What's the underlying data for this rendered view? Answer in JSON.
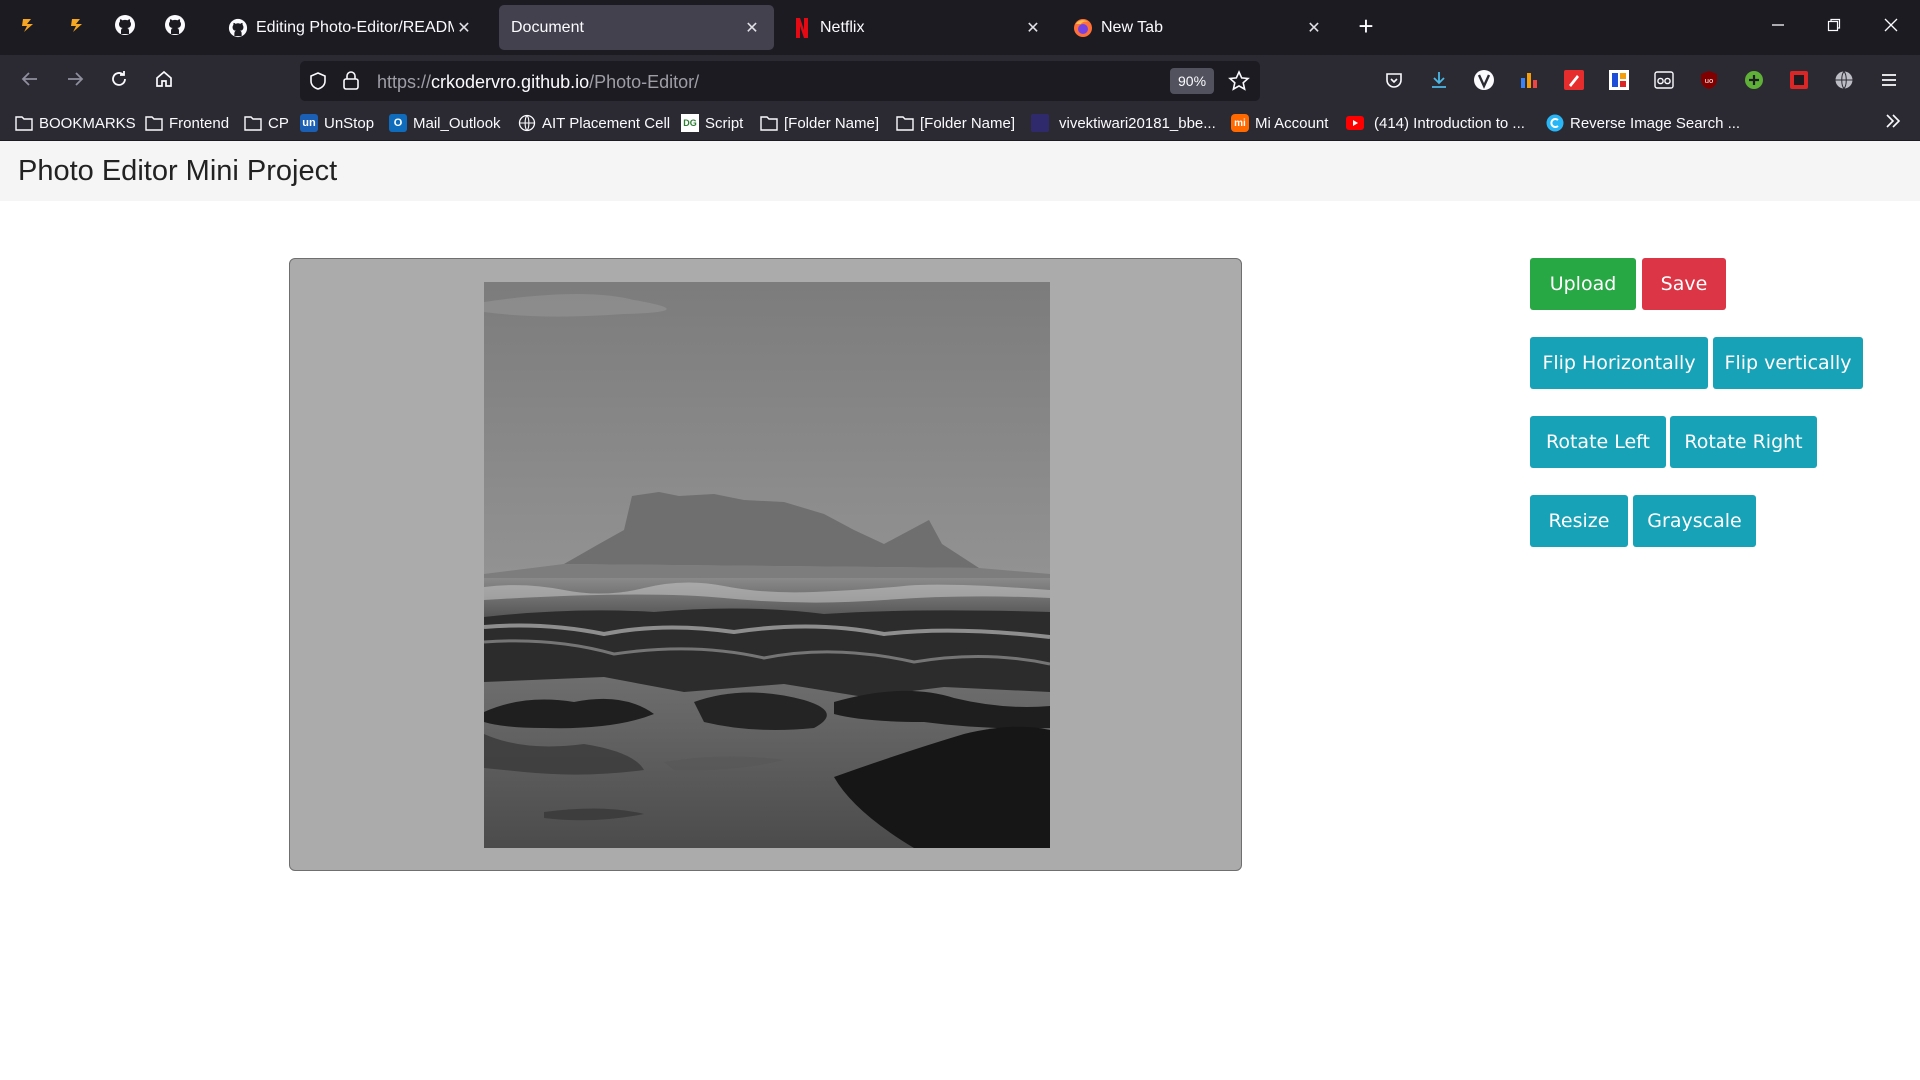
{
  "browser": {
    "tabs": [
      {
        "title": "Editing Photo-Editor/README.md",
        "active": false
      },
      {
        "title": "Document",
        "active": true
      },
      {
        "title": "Netflix",
        "active": false
      },
      {
        "title": "New Tab",
        "active": false
      }
    ],
    "url": {
      "scheme": "https://",
      "host": "crkodervro.github.io",
      "path": "/Photo-Editor/"
    },
    "zoom": "90%",
    "bookmarks": [
      {
        "label": "BOOKMARKS",
        "icon": "folder-icon"
      },
      {
        "label": "Frontend",
        "icon": "folder-icon"
      },
      {
        "label": "CP",
        "icon": "folder-icon"
      },
      {
        "label": "UnStop",
        "icon": "unstop-icon"
      },
      {
        "label": "Mail_Outlook",
        "icon": "outlook-icon"
      },
      {
        "label": "AIT Placement Cell",
        "icon": "globe-icon"
      },
      {
        "label": "Script",
        "icon": "script-icon"
      },
      {
        "label": "[Folder Name]",
        "icon": "folder-icon"
      },
      {
        "label": "[Folder Name]",
        "icon": "folder-icon"
      },
      {
        "label": "vivektiwari20181_bbe...",
        "icon": "site-icon"
      },
      {
        "label": "Mi Account",
        "icon": "mi-icon"
      },
      {
        "label": "(414) Introduction to ...",
        "icon": "youtube-icon"
      },
      {
        "label": "Reverse Image Search ...",
        "icon": "reverse-search-icon"
      }
    ]
  },
  "page": {
    "title": "Photo Editor Mini Project",
    "buttons": {
      "upload": "Upload",
      "save": "Save",
      "flip_h": "Flip Horizontally",
      "flip_v": "Flip vertically",
      "rotate_left": "Rotate Left",
      "rotate_right": "Rotate Right",
      "resize": "Resize",
      "grayscale": "Grayscale"
    },
    "photo_filter": "grayscale",
    "colors": {
      "upload": "#28a745",
      "save": "#dc3545",
      "action": "#17a2b8"
    }
  }
}
